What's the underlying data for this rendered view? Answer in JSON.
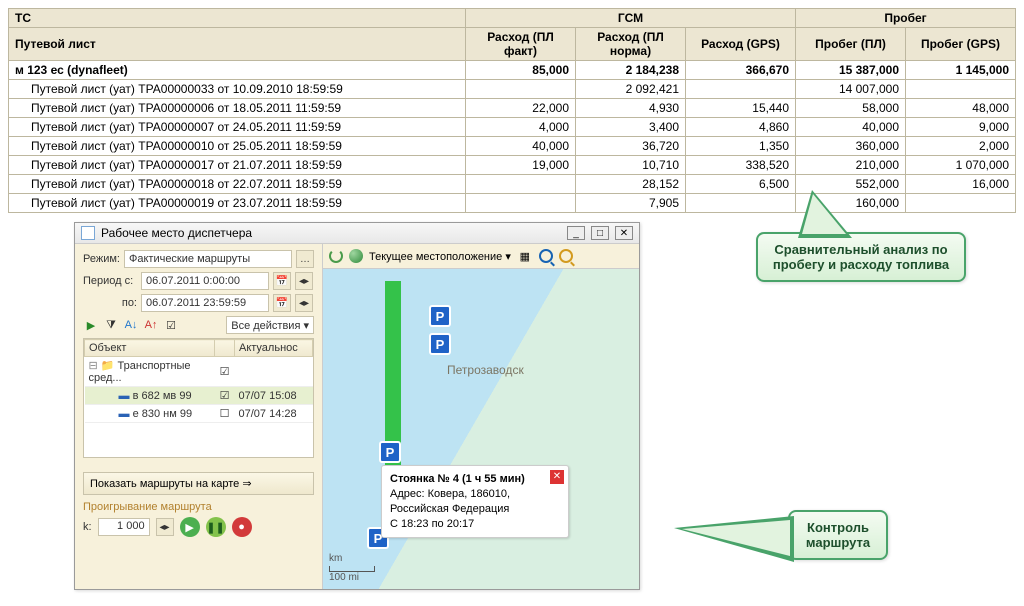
{
  "table": {
    "headers": {
      "ts": "ТС",
      "gsm": "ГСМ",
      "mileage": "Пробег",
      "waybill": "Путевой лист",
      "fuel_fact": "Расход (ПЛ факт)",
      "fuel_norm": "Расход (ПЛ норма)",
      "fuel_gps": "Расход (GPS)",
      "run_pl": "Пробег (ПЛ)",
      "run_gps": "Пробег (GPS)"
    },
    "summary": {
      "name": "м 123 ес (dynafleet)",
      "fuel_fact": "85,000",
      "fuel_norm": "2 184,238",
      "fuel_gps": "366,670",
      "run_pl": "15 387,000",
      "run_gps": "1 145,000"
    },
    "rows": [
      {
        "name": "Путевой лист (уат) ТРА00000033 от 10.09.2010 18:59:59",
        "fuel_fact": "",
        "fuel_norm": "2 092,421",
        "fuel_gps": "",
        "run_pl": "14 007,000",
        "run_gps": ""
      },
      {
        "name": "Путевой лист (уат) ТРА00000006 от 18.05.2011 11:59:59",
        "fuel_fact": "22,000",
        "fuel_norm": "4,930",
        "fuel_gps": "15,440",
        "run_pl": "58,000",
        "run_gps": "48,000"
      },
      {
        "name": "Путевой лист (уат) ТРА00000007 от 24.05.2011 11:59:59",
        "fuel_fact": "4,000",
        "fuel_norm": "3,400",
        "fuel_gps": "4,860",
        "run_pl": "40,000",
        "run_gps": "9,000"
      },
      {
        "name": "Путевой лист (уат) ТРА00000010 от 25.05.2011 18:59:59",
        "fuel_fact": "40,000",
        "fuel_norm": "36,720",
        "fuel_gps": "1,350",
        "run_pl": "360,000",
        "run_gps": "2,000"
      },
      {
        "name": "Путевой лист (уат) ТРА00000017 от 21.07.2011 18:59:59",
        "fuel_fact": "19,000",
        "fuel_norm": "10,710",
        "fuel_gps": "338,520",
        "run_pl": "210,000",
        "run_gps": "1 070,000"
      },
      {
        "name": "Путевой лист (уат) ТРА00000018 от 22.07.2011 18:59:59",
        "fuel_fact": "",
        "fuel_norm": "28,152",
        "fuel_gps": "6,500",
        "run_pl": "552,000",
        "run_gps": "16,000"
      },
      {
        "name": "Путевой лист (уат) ТРА00000019 от 23.07.2011 18:59:59",
        "fuel_fact": "",
        "fuel_norm": "7,905",
        "fuel_gps": "",
        "run_pl": "160,000",
        "run_gps": ""
      }
    ]
  },
  "dispatcher": {
    "title": "Рабочее место диспетчера",
    "mode_label": "Режим:",
    "mode_value": "Фактические маршруты",
    "period_label": "Период с:",
    "period_to": "по:",
    "date_from": "06.07.2011 0:00:00",
    "date_to": "06.07.2011 23:59:59",
    "all_actions": "Все действия ▾",
    "tree": {
      "col_object": "Объект",
      "col_checkbox": "",
      "col_time": "Актуальнос",
      "group": "Транспортные сред...",
      "items": [
        {
          "name": "в 682 мв 99",
          "checked": true,
          "time": "07/07 15:08"
        },
        {
          "name": "е 830 нм 99",
          "checked": false,
          "time": "07/07 14:28"
        }
      ]
    },
    "show_routes": "Показать маршруты на карте  ⇒",
    "playback_label": "Проигрывание маршрута",
    "k_label": "k:",
    "k_value": "1 000"
  },
  "map": {
    "refresh_icon": "⟳",
    "current_location": "Текущее местоположение ▾",
    "city": "Петрозаводск",
    "scale_unit": "km",
    "scale_val": "100 mi",
    "tooltip": {
      "title": "Стоянка № 4 (1 ч 55 мин)",
      "addr_label": "Адрес:",
      "addr": "Ковера, 186010, Российская Федерация",
      "time": "С 18:23 по 20:17"
    }
  },
  "callouts": {
    "analysis": "Сравнительный анализ по пробегу и расходу топлива",
    "route_control": "Контроль маршрута"
  }
}
